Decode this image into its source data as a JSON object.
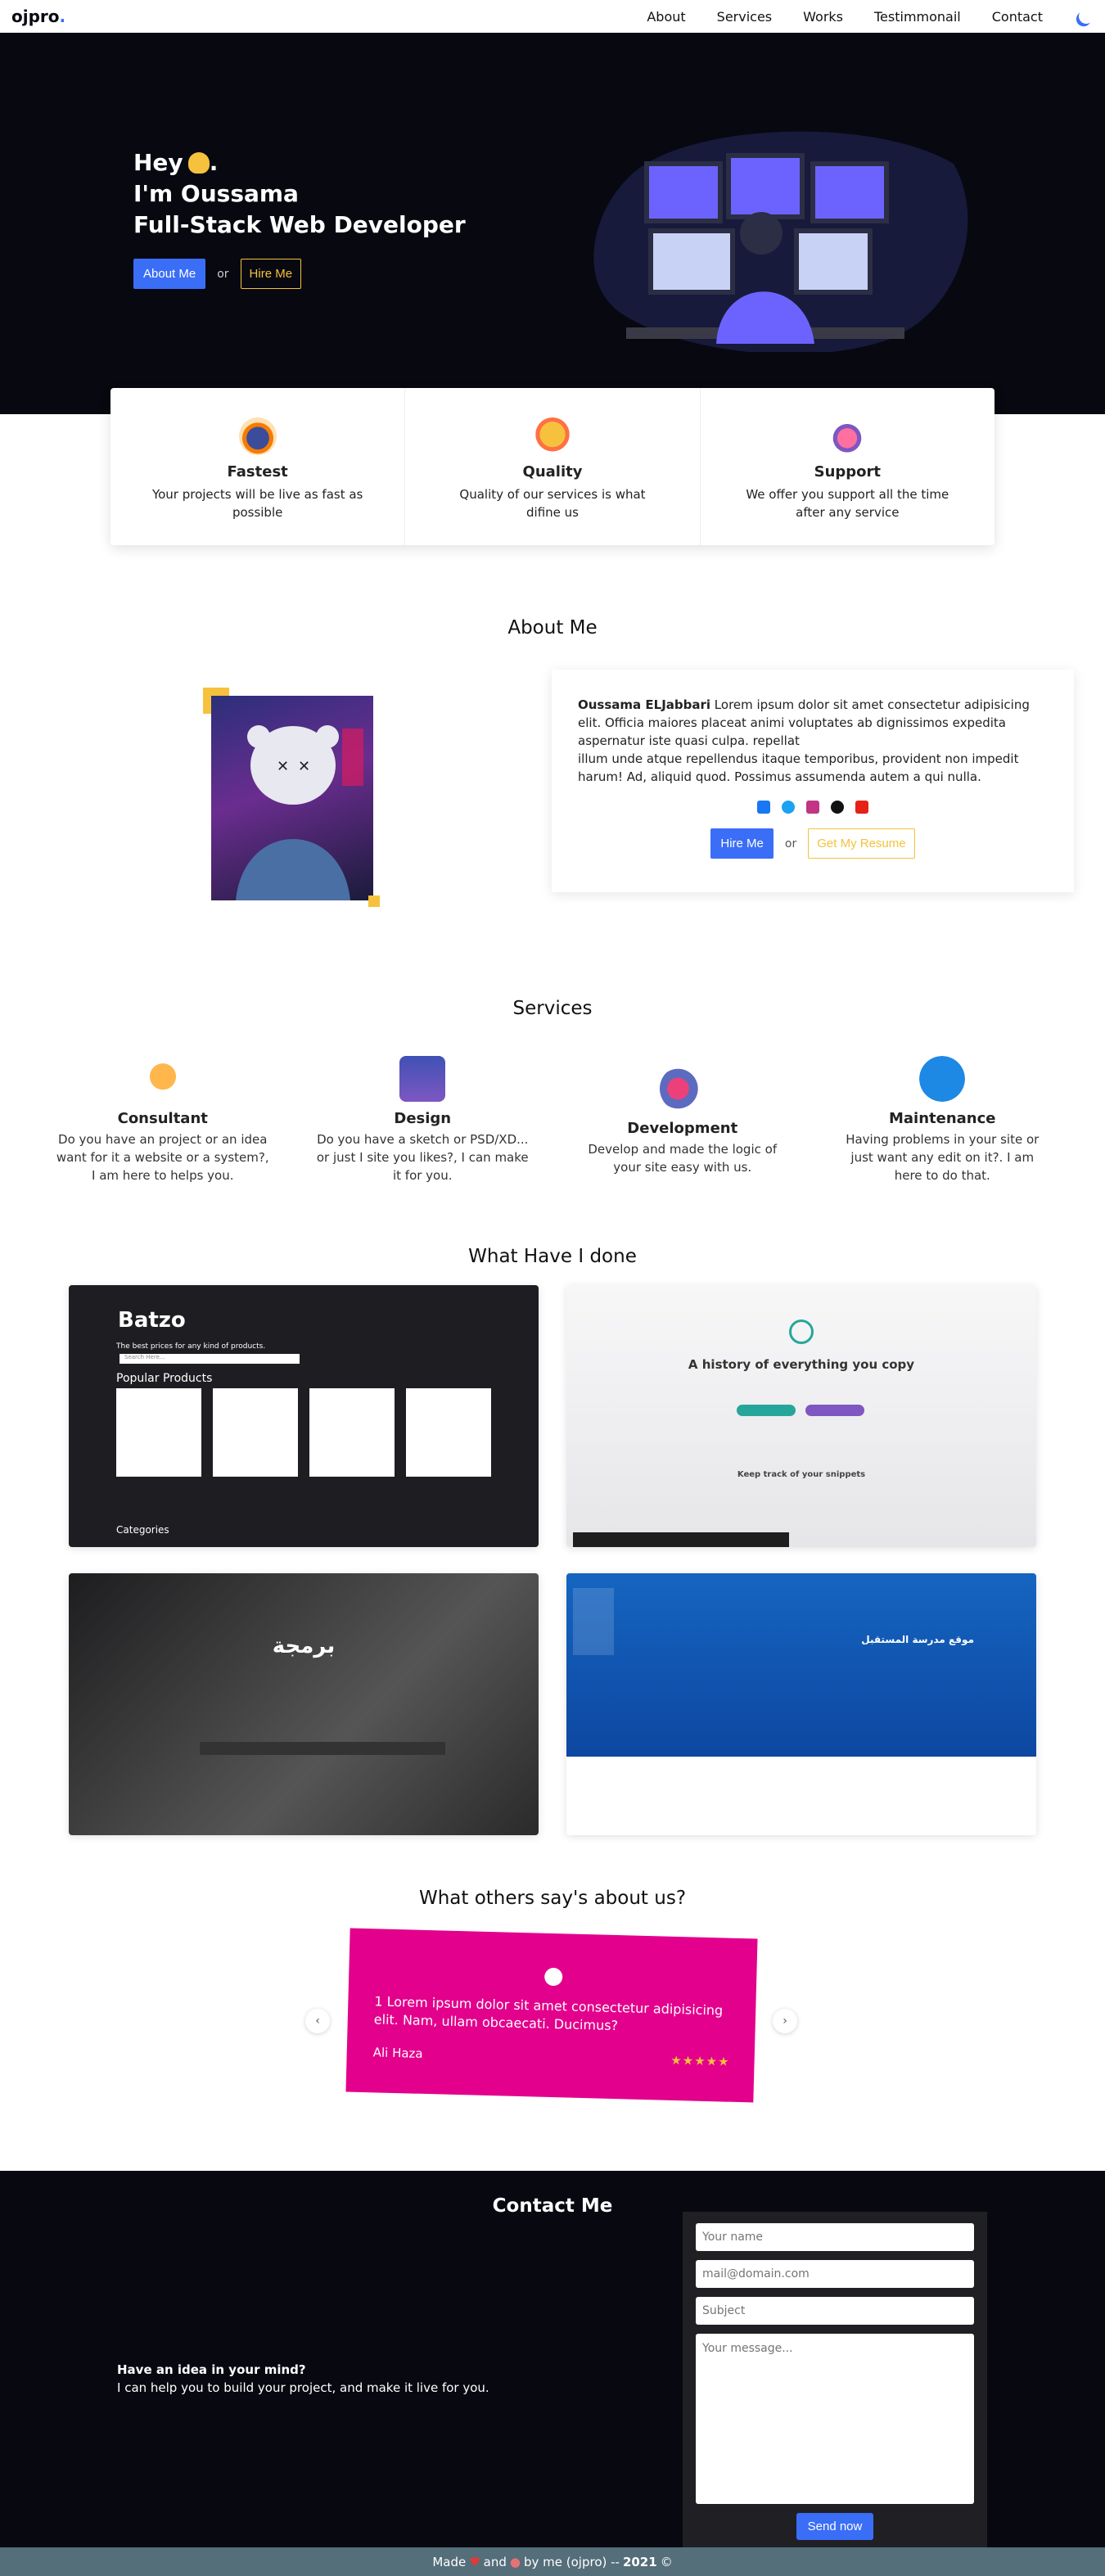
{
  "nav": {
    "logo": "ojpro",
    "logo_dot": ".",
    "links": [
      "About",
      "Services",
      "Works",
      "Testimmonail",
      "Contact"
    ]
  },
  "hero": {
    "line1": "Hey",
    "line1_end": ".",
    "line2": "I'm Oussama",
    "line3": "Full-Stack Web Developer",
    "about_btn": "About Me",
    "or": "or",
    "hire_btn": "Hire Me"
  },
  "features": [
    {
      "title": "Fastest",
      "text": "Your projects will be live as fast as possible",
      "icon": "stopwatch-icon"
    },
    {
      "title": "Quality",
      "text": "Quality of our services is what difine us",
      "icon": "medal-icon"
    },
    {
      "title": "Support",
      "text": "We offer you support all the time after any service",
      "icon": "headset-icon"
    }
  ],
  "about": {
    "heading": "About Me",
    "name": "Oussama ELJabbari",
    "text1": " Lorem ipsum dolor sit amet consectetur adipisicing elit. Officia maiores placeat animi voluptates ab dignissimos expedita aspernatur iste quasi culpa. repellat",
    "text2": "illum unde atque repellendus itaque temporibus, provident non impedit harum! Ad, aliquid quod. Possimus assumenda autem a qui nulla.",
    "hire_btn": "Hire Me",
    "or": "or",
    "resume_btn": "Get My Resume",
    "social_colors": [
      "#1877f2",
      "#1da1f2",
      "#c13584",
      "#111111",
      "#e62117"
    ]
  },
  "services": {
    "heading": "Services",
    "items": [
      {
        "title": "Consultant",
        "text": "Do you have an project or an idea want for it a website or a system?, I am here to helps you."
      },
      {
        "title": "Design",
        "text": "Do you have a sketch or PSD/XD... or just I site you likes?, I can make it for you."
      },
      {
        "title": "Development",
        "text": "Develop and made the logic of your site easy with us."
      },
      {
        "title": "Maintenance",
        "text": "Having problems in your site or just want any edit on it?. I am here to do that."
      }
    ]
  },
  "works": {
    "heading": "What Have I done",
    "batzo": {
      "brand": "Batzo",
      "sub": "The best prices for any kind of products.",
      "search": "Search Here...",
      "popular": "Popular Products",
      "categories": "Categories"
    },
    "clip": {
      "title": "A history of everything you copy",
      "subtitle": "Keep track of your snippets"
    },
    "code_title": "برمجة",
    "school_title": "موقع مدرسة المستقبل"
  },
  "testimonials": {
    "heading": "What others say's about us?",
    "text": "1 Lorem ipsum dolor sit amet consectetur adipisicing elit. Nam, ullam obcaecati. Ducimus?",
    "name": "Ali Haza",
    "stars": "★★★★★"
  },
  "contact": {
    "heading": "Contact Me",
    "idea_title": "Have an idea in your mind?",
    "idea_text": "I can help you to build your project, and make it live for you.",
    "name_ph": "Your name",
    "mail_ph": "mail@domain.com",
    "subject_ph": "Subject",
    "message_ph": "Your message...",
    "send": "Send now"
  },
  "footer": {
    "made": "Made",
    "and": "and",
    "by": "by me (ojpro) --",
    "year": "2021",
    "copy": "©"
  }
}
